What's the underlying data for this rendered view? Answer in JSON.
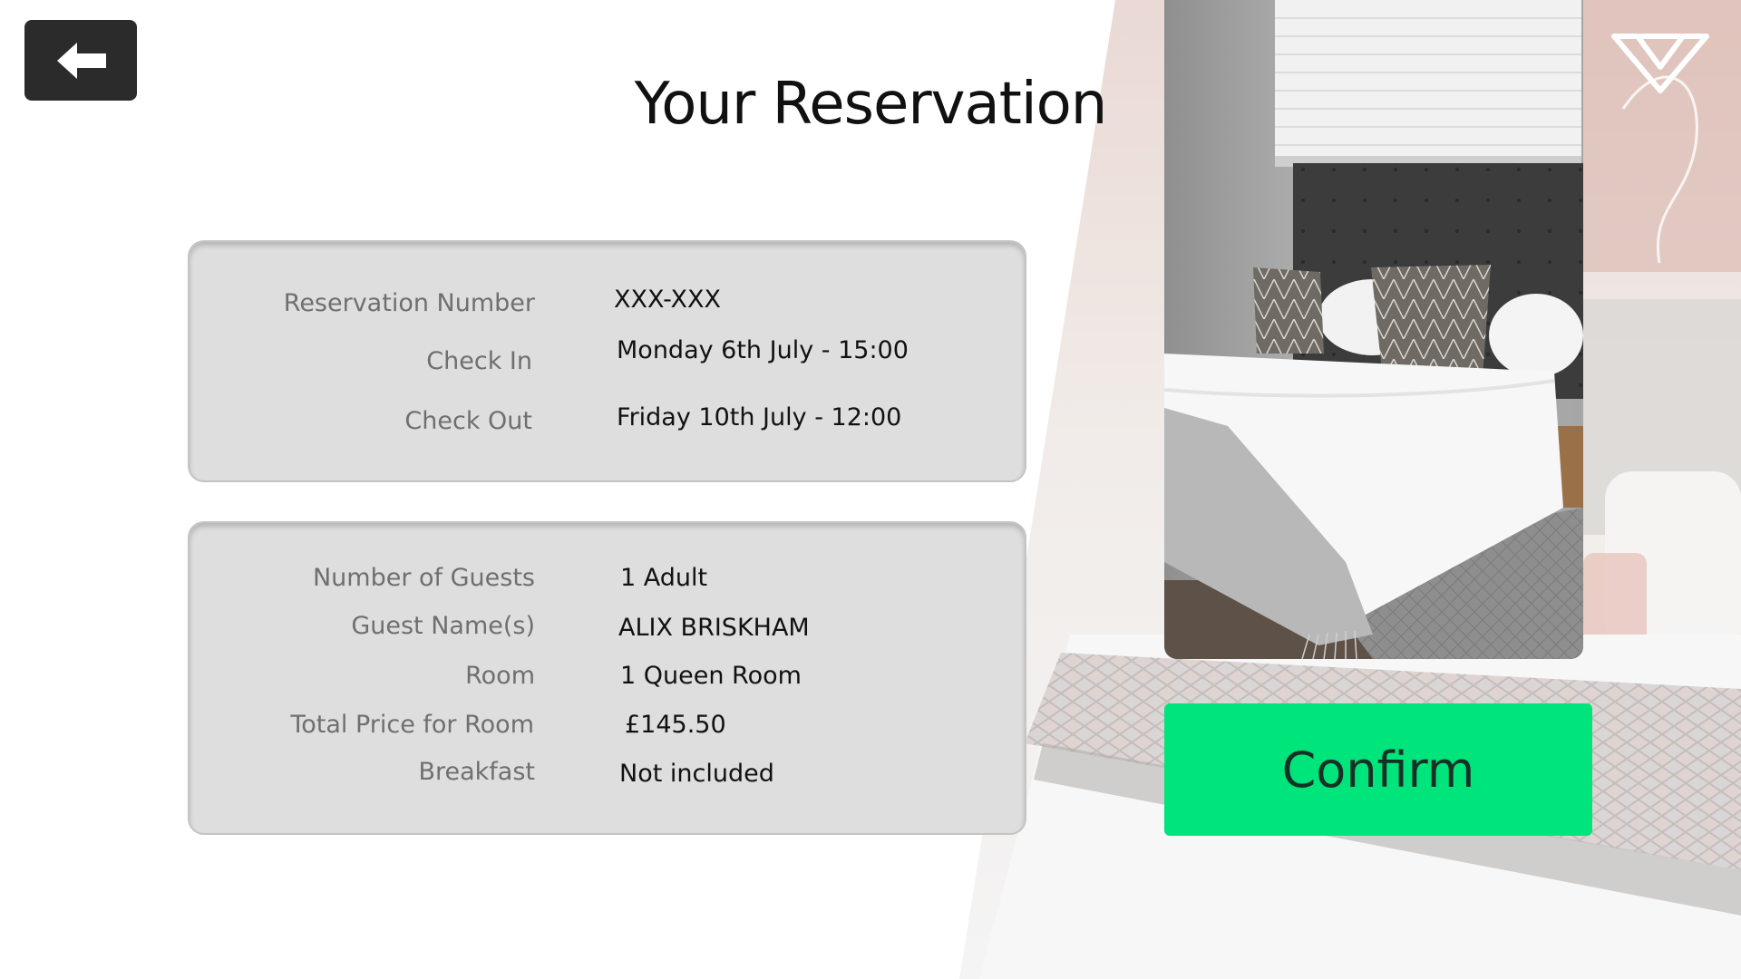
{
  "header": {
    "title": "Your Reservation",
    "back_button_icon": "arrow-left-icon"
  },
  "reservation": {
    "rows": [
      {
        "label": "Reservation Number",
        "value": "XXX-XXX"
      },
      {
        "label": "Check In",
        "value": "Monday 6th July - 15:00"
      },
      {
        "label": "Check Out",
        "value": "Friday 10th July - 12:00"
      }
    ]
  },
  "details": {
    "rows": [
      {
        "label": "Number of Guests",
        "value": "1 Adult"
      },
      {
        "label": "Guest Name(s)",
        "value": "ALIX BRISKHAM"
      },
      {
        "label": "Room",
        "value": "1 Queen Room"
      },
      {
        "label": "Total Price for Room",
        "value": "£145.50"
      },
      {
        "label": "Breakfast",
        "value": "Not included"
      }
    ]
  },
  "actions": {
    "confirm_label": "Confirm"
  },
  "colors": {
    "accent": "#00e47c",
    "back_button": "#2b2b2b",
    "card_background": "#dedede"
  },
  "icons": {
    "brand_logo": "brand-logo-icon",
    "room_photo": "hotel-room-photo"
  }
}
